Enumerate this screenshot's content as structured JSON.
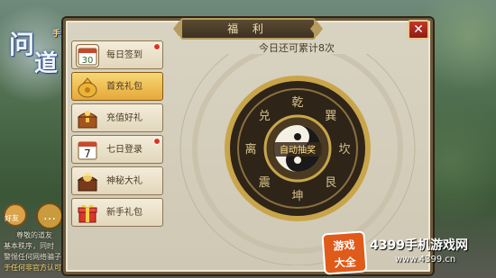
{
  "panel": {
    "title": "福 利",
    "close_label": "✕"
  },
  "sidebar": {
    "items": [
      {
        "label": "每日签到",
        "icon": "calendar-30-icon",
        "active": false,
        "badge": true
      },
      {
        "label": "首充礼包",
        "icon": "money-bag-icon",
        "active": true,
        "badge": false
      },
      {
        "label": "充值好礼",
        "icon": "treasure-chest-icon",
        "active": false,
        "badge": false
      },
      {
        "label": "七日登录",
        "icon": "calendar-7-icon",
        "active": false,
        "badge": true
      },
      {
        "label": "神秘大礼",
        "icon": "mystery-chest-icon",
        "active": false,
        "badge": false
      },
      {
        "label": "新手礼包",
        "icon": "gift-box-icon",
        "active": false,
        "badge": false
      }
    ],
    "icon_badges": {
      "calendar_30": "30",
      "calendar_7": "7"
    }
  },
  "content": {
    "counter_text": "今日还可累计8次",
    "center_button": "自动抽奖",
    "trigrams": [
      "乾",
      "巽",
      "坎",
      "艮",
      "坤",
      "震",
      "离",
      "兑"
    ]
  },
  "game": {
    "logo_chars": [
      "问",
      "道"
    ],
    "logo_tag": "手游",
    "friend_label": "好友",
    "chat_lines": [
      "尊敬的道友",
      "基本秩序，同时",
      "警惕任何网络骗子",
      "于任何非官方认可的平台，代理充值或"
    ]
  },
  "watermark": {
    "badge_top": "游戏",
    "badge_bottom": "大全",
    "site_title": "4399手机游戏网",
    "url": "www.4399.cn"
  },
  "colors": {
    "panel_bg": "#d9d3c2",
    "active_tab": "#f0c35a",
    "close_red": "#b02a20",
    "badge_red": "#e0331d",
    "wheel_gold": "#c9a54a",
    "wheel_dark": "#3a2c1a"
  }
}
